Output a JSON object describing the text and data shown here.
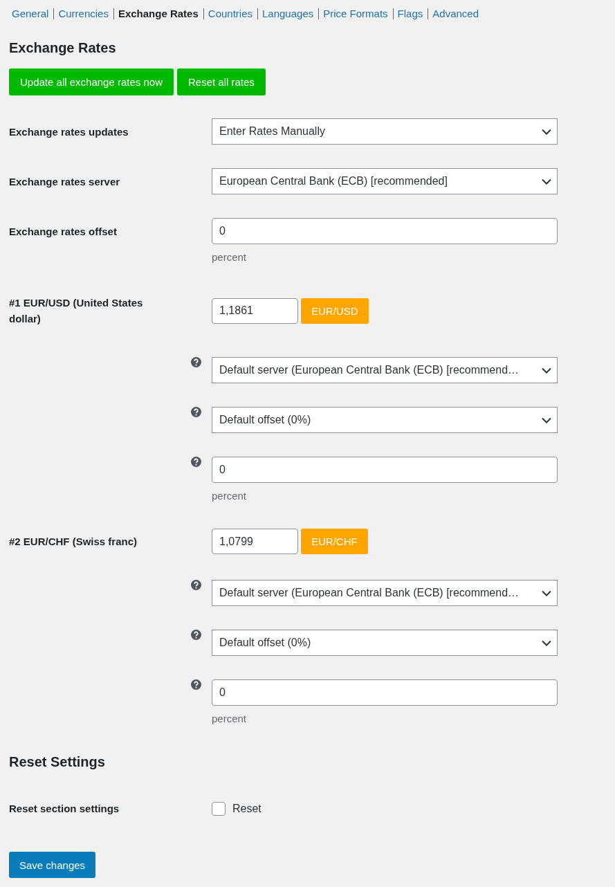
{
  "tabs": [
    {
      "label": "General",
      "selected": false
    },
    {
      "label": "Currencies",
      "selected": false
    },
    {
      "label": "Exchange Rates",
      "selected": true
    },
    {
      "label": "Countries",
      "selected": false
    },
    {
      "label": "Languages",
      "selected": false
    },
    {
      "label": "Price Formats",
      "selected": false
    },
    {
      "label": "Flags",
      "selected": false
    },
    {
      "label": "Advanced",
      "selected": false
    }
  ],
  "title": "Exchange Rates",
  "actions": [
    "Update all exchange rates now",
    "Reset all rates"
  ],
  "settings": [
    {
      "label": "Exchange rates updates",
      "kind": "select",
      "value": "Enter Rates Manually"
    },
    {
      "label": "Exchange rates server",
      "kind": "select",
      "value": "European Central Bank (ECB) [recommended]"
    },
    {
      "label": "Exchange rates offset",
      "kind": "input",
      "value": "0",
      "description": "percent"
    }
  ],
  "currencies": [
    {
      "label": "#1 EUR/USD (United States dollar)",
      "rate": "1,1861",
      "pair_button": "EUR/USD",
      "options": [
        {
          "kind": "select",
          "value": "Default server (European Central Bank (ECB) [recommend…"
        },
        {
          "kind": "select",
          "value": "Default offset (0%)"
        },
        {
          "kind": "input",
          "value": "0",
          "description": "percent"
        }
      ]
    },
    {
      "label": "#2 EUR/CHF (Swiss franc)",
      "rate": "1,0799",
      "pair_button": "EUR/CHF",
      "options": [
        {
          "kind": "select",
          "value": "Default server (European Central Bank (ECB) [recommend…"
        },
        {
          "kind": "select",
          "value": "Default offset (0%)"
        },
        {
          "kind": "input",
          "value": "0",
          "description": "percent"
        }
      ]
    }
  ],
  "reset_section": {
    "title": "Reset Settings",
    "label": "Reset section settings",
    "checkbox": {
      "label": "Reset",
      "checked": false
    }
  },
  "save_button": "Save changes"
}
